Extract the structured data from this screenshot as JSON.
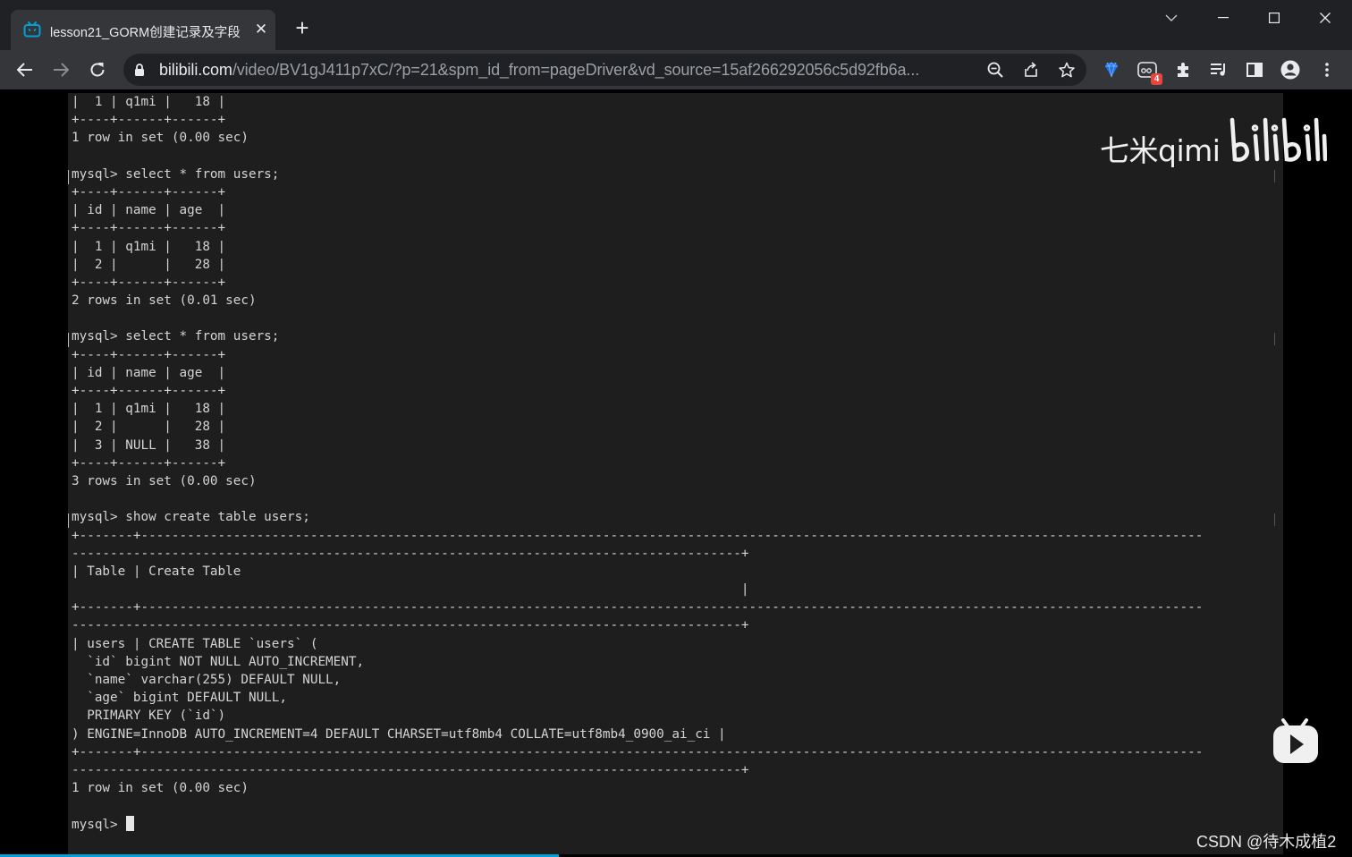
{
  "browser": {
    "tab": {
      "title": "lesson21_GORM创建记录及字段",
      "close_glyph": "✕",
      "icon": "bilibili-tv-icon"
    },
    "new_tab_glyph": "+",
    "address": {
      "host": "bilibili.com",
      "path": "/video/BV1gJ411p7xC/?p=21&spm_id_from=pageDriver&vd_source=15af266292056c5d92fb6a..."
    },
    "extension_badge": "4",
    "accent_color": "#00a1d6"
  },
  "terminal": {
    "lines": [
      "|  1 | q1mi |   18 |",
      "+----+------+------+",
      "1 row in set (0.00 sec)",
      "",
      "mysql> select * from users;",
      "+----+------+------+",
      "| id | name | age  |",
      "+----+------+------+",
      "|  1 | q1mi |   18 |",
      "|  2 |      |   28 |",
      "+----+------+------+",
      "2 rows in set (0.01 sec)",
      "",
      "mysql> select * from users;",
      "+----+------+------+",
      "| id | name | age  |",
      "+----+------+------+",
      "|  1 | q1mi |   18 |",
      "|  2 |      |   28 |",
      "|  3 | NULL |   38 |",
      "+----+------+------+",
      "3 rows in set (0.00 sec)",
      "",
      "mysql> show create table users;",
      "+-------+------------------------------------------------------------------------------------------------------------------------------------------",
      "---------------------------------------------------------------------------------------+",
      "| Table | Create Table",
      "                                                                                       |",
      "+-------+------------------------------------------------------------------------------------------------------------------------------------------",
      "---------------------------------------------------------------------------------------+",
      "| users | CREATE TABLE `users` (",
      "  `id` bigint NOT NULL AUTO_INCREMENT,",
      "  `name` varchar(255) DEFAULT NULL,",
      "  `age` bigint DEFAULT NULL,",
      "  PRIMARY KEY (`id`)",
      ") ENGINE=InnoDB AUTO_INCREMENT=4 DEFAULT CHARSET=utf8mb4 COLLATE=utf8mb4_0900_ai_ci |",
      "+-------+------------------------------------------------------------------------------------------------------------------------------------------",
      "---------------------------------------------------------------------------------------+",
      "1 row in set (0.00 sec)",
      ""
    ],
    "prompt": "mysql> "
  },
  "watermark": {
    "text": "七米qimi",
    "logo": "bilibili"
  },
  "credit": "CSDN @待木成植2"
}
